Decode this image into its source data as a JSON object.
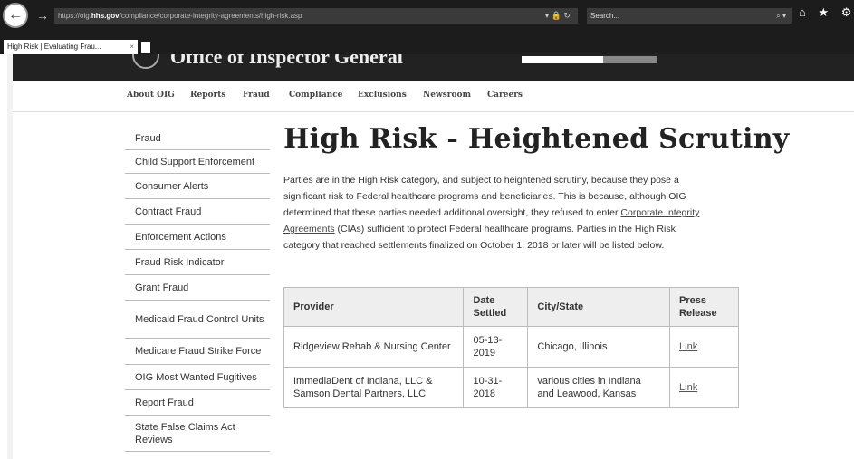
{
  "browser": {
    "url_prefix": "https://oig.",
    "url_host": "hhs.gov",
    "url_path": "/compliance/corporate-integrity-agreements/high-risk.asp",
    "url_controls": "▾ 🔒 ↻",
    "search_placeholder": "Search...",
    "search_controls": "⌕ ▾",
    "toolbar_icons": "⌂ ★ ⚙",
    "tab_title": "High Risk | Evaluating Frau...",
    "tab_close": "×"
  },
  "site": {
    "title": "Office of Inspector General"
  },
  "nav": {
    "items": [
      "About OIG",
      "Reports",
      "Fraud",
      "Compliance",
      "Exclusions",
      "Newsroom",
      "Careers"
    ]
  },
  "sidebar": {
    "items": [
      "Fraud",
      "Child Support Enforcement",
      "Consumer Alerts",
      "Contract Fraud",
      "Enforcement Actions",
      "Fraud Risk Indicator",
      "Grant Fraud",
      "Medicaid Fraud Control Units",
      "Medicare Fraud Strike Force",
      "OIG Most Wanted Fugitives",
      "Report Fraud",
      "State False Claims Act Reviews"
    ]
  },
  "content": {
    "title": "High Risk - Heightened Scrutiny",
    "intro_part1": "Parties are in the High Risk category, and subject to heightened scrutiny, because they pose a significant risk to Federal healthcare programs and beneficiaries. This is because, although OIG determined that these parties needed additional oversight, they refused to enter ",
    "intro_link": "Corporate Integrity Agreements",
    "intro_part2": " (CIAs) sufficient to protect Federal healthcare programs. Parties in the High Risk category that reached settlements finalized on October 1, 2018 or later will be listed below.",
    "table": {
      "headers": [
        "Provider",
        "Date Settled",
        "City/State",
        "Press Release"
      ],
      "rows": [
        [
          "Ridgeview Rehab & Nursing Center",
          "05-13-2019",
          "Chicago, Illinois",
          "Link"
        ],
        [
          "ImmediaDent of Indiana, LLC & Samson Dental Partners, LLC",
          "10-31-2018",
          "various cities in Indiana and Leawood, Kansas",
          "Link"
        ]
      ]
    }
  }
}
